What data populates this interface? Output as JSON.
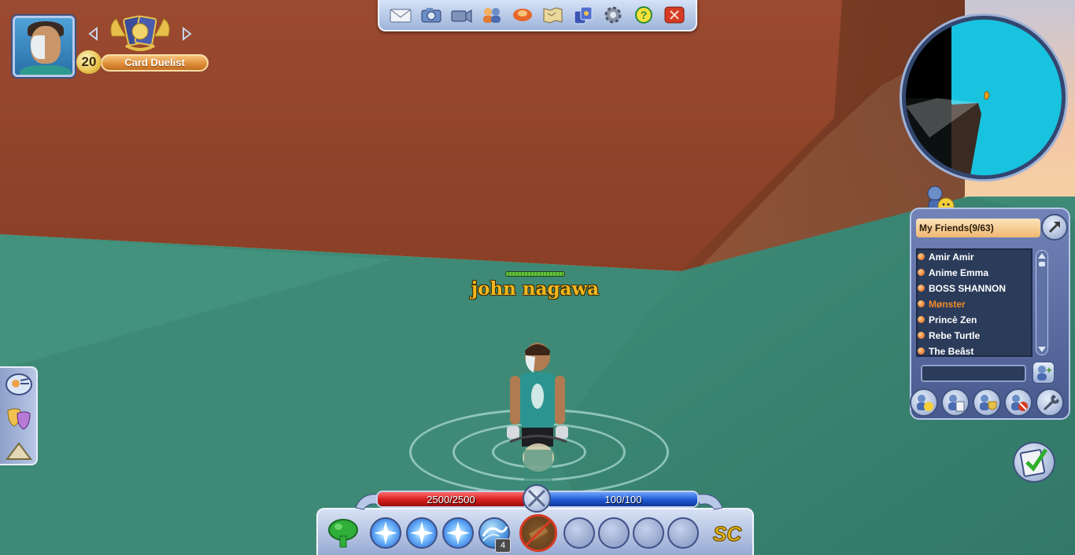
{
  "player": {
    "level": "20",
    "title": "Card Duelist",
    "name": "john nagawa"
  },
  "top_toolbar": {
    "buttons": [
      "mail-icon",
      "camera-icon",
      "video-icon",
      "friends-icon",
      "duel-icon",
      "map-icon",
      "cards-icon",
      "gear-icon",
      "help-icon",
      "close-icon"
    ]
  },
  "friends": {
    "header": "My Friends(9/63)",
    "list": [
      {
        "name": "Amir Amir"
      },
      {
        "name": "Anime Emma"
      },
      {
        "name": "BOSS SHANNON"
      },
      {
        "name": "Mønster"
      },
      {
        "name": "Princè Zen"
      },
      {
        "name": "Rebe Turtle"
      },
      {
        "name": "The Beâst"
      }
    ],
    "search_value": "",
    "bottom_buttons": [
      "friend-online-icon",
      "friend-list-icon",
      "guild-icon",
      "blocked-icon",
      "settings-wrench-icon"
    ]
  },
  "status": {
    "hp_text": "2500/2500",
    "hp_fraction": 1.0,
    "mp_text": "100/100",
    "mp_fraction": 1.0
  },
  "hotbar": {
    "slot_count_badge": "4",
    "logo": "SC"
  },
  "colors": {
    "hp": "#d41d1d",
    "mp": "#1f58d4",
    "name": "#f2b81c",
    "minimap_water": "#18c3e0"
  }
}
